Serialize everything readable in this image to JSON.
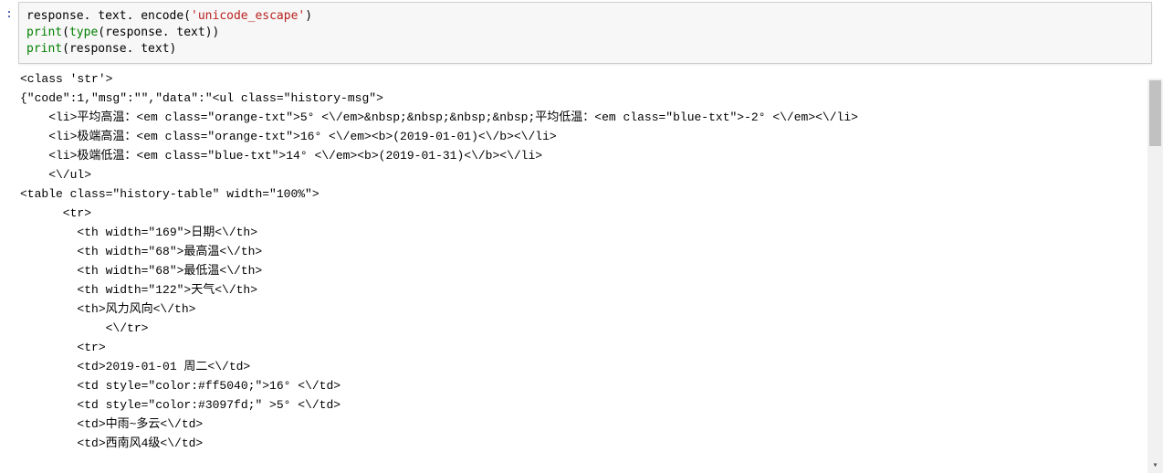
{
  "code": {
    "prompt": ":",
    "line1": {
      "pre": "response. text. encode(",
      "str": "'unicode_escape'",
      "post": ")"
    },
    "line2": {
      "print": "print",
      "open": "(",
      "type": "type",
      "open2": "(",
      "arg": "response. text",
      "close2": ")",
      "close": ")"
    },
    "line3": {
      "print": "print",
      "open": "(",
      "arg": "response. text",
      "close": ")"
    }
  },
  "output": {
    "l01": "<class 'str'>",
    "l02": "{\"code\":1,\"msg\":\"\",\"data\":\"<ul class=\"history-msg\">",
    "l03": "    <li>平均高温：<em class=\"orange-txt\">5° <\\/em>&nbsp;&nbsp;&nbsp;&nbsp;平均低温：<em class=\"blue-txt\">-2° <\\/em><\\/li>",
    "l04": "    <li>极端高温：<em class=\"orange-txt\">16° <\\/em><b>(2019-01-01)<\\/b><\\/li>",
    "l05": "    <li>极端低温：<em class=\"blue-txt\">14° <\\/em><b>(2019-01-31)<\\/b><\\/li>",
    "l06": "    <\\/ul>",
    "l07": "<table class=\"history-table\" width=\"100%\">",
    "l08": "      <tr>",
    "l09": "        <th width=\"169\">日期<\\/th>",
    "l10": "        <th width=\"68\">最高温<\\/th>",
    "l11": "        <th width=\"68\">最低温<\\/th>",
    "l12": "        <th width=\"122\">天气<\\/th>",
    "l13": "        <th>风力风向<\\/th>",
    "l14": "            <\\/tr>",
    "l15": "        <tr>",
    "l16": "        <td>2019-01-01 周二<\\/td>",
    "l17": "        <td style=\"color:#ff5040;\">16° <\\/td>",
    "l18": "        <td style=\"color:#3097fd;\" >5° <\\/td>",
    "l19": "        <td>中雨~多云<\\/td>",
    "l20": "        <td>西南风4级<\\/td>"
  }
}
